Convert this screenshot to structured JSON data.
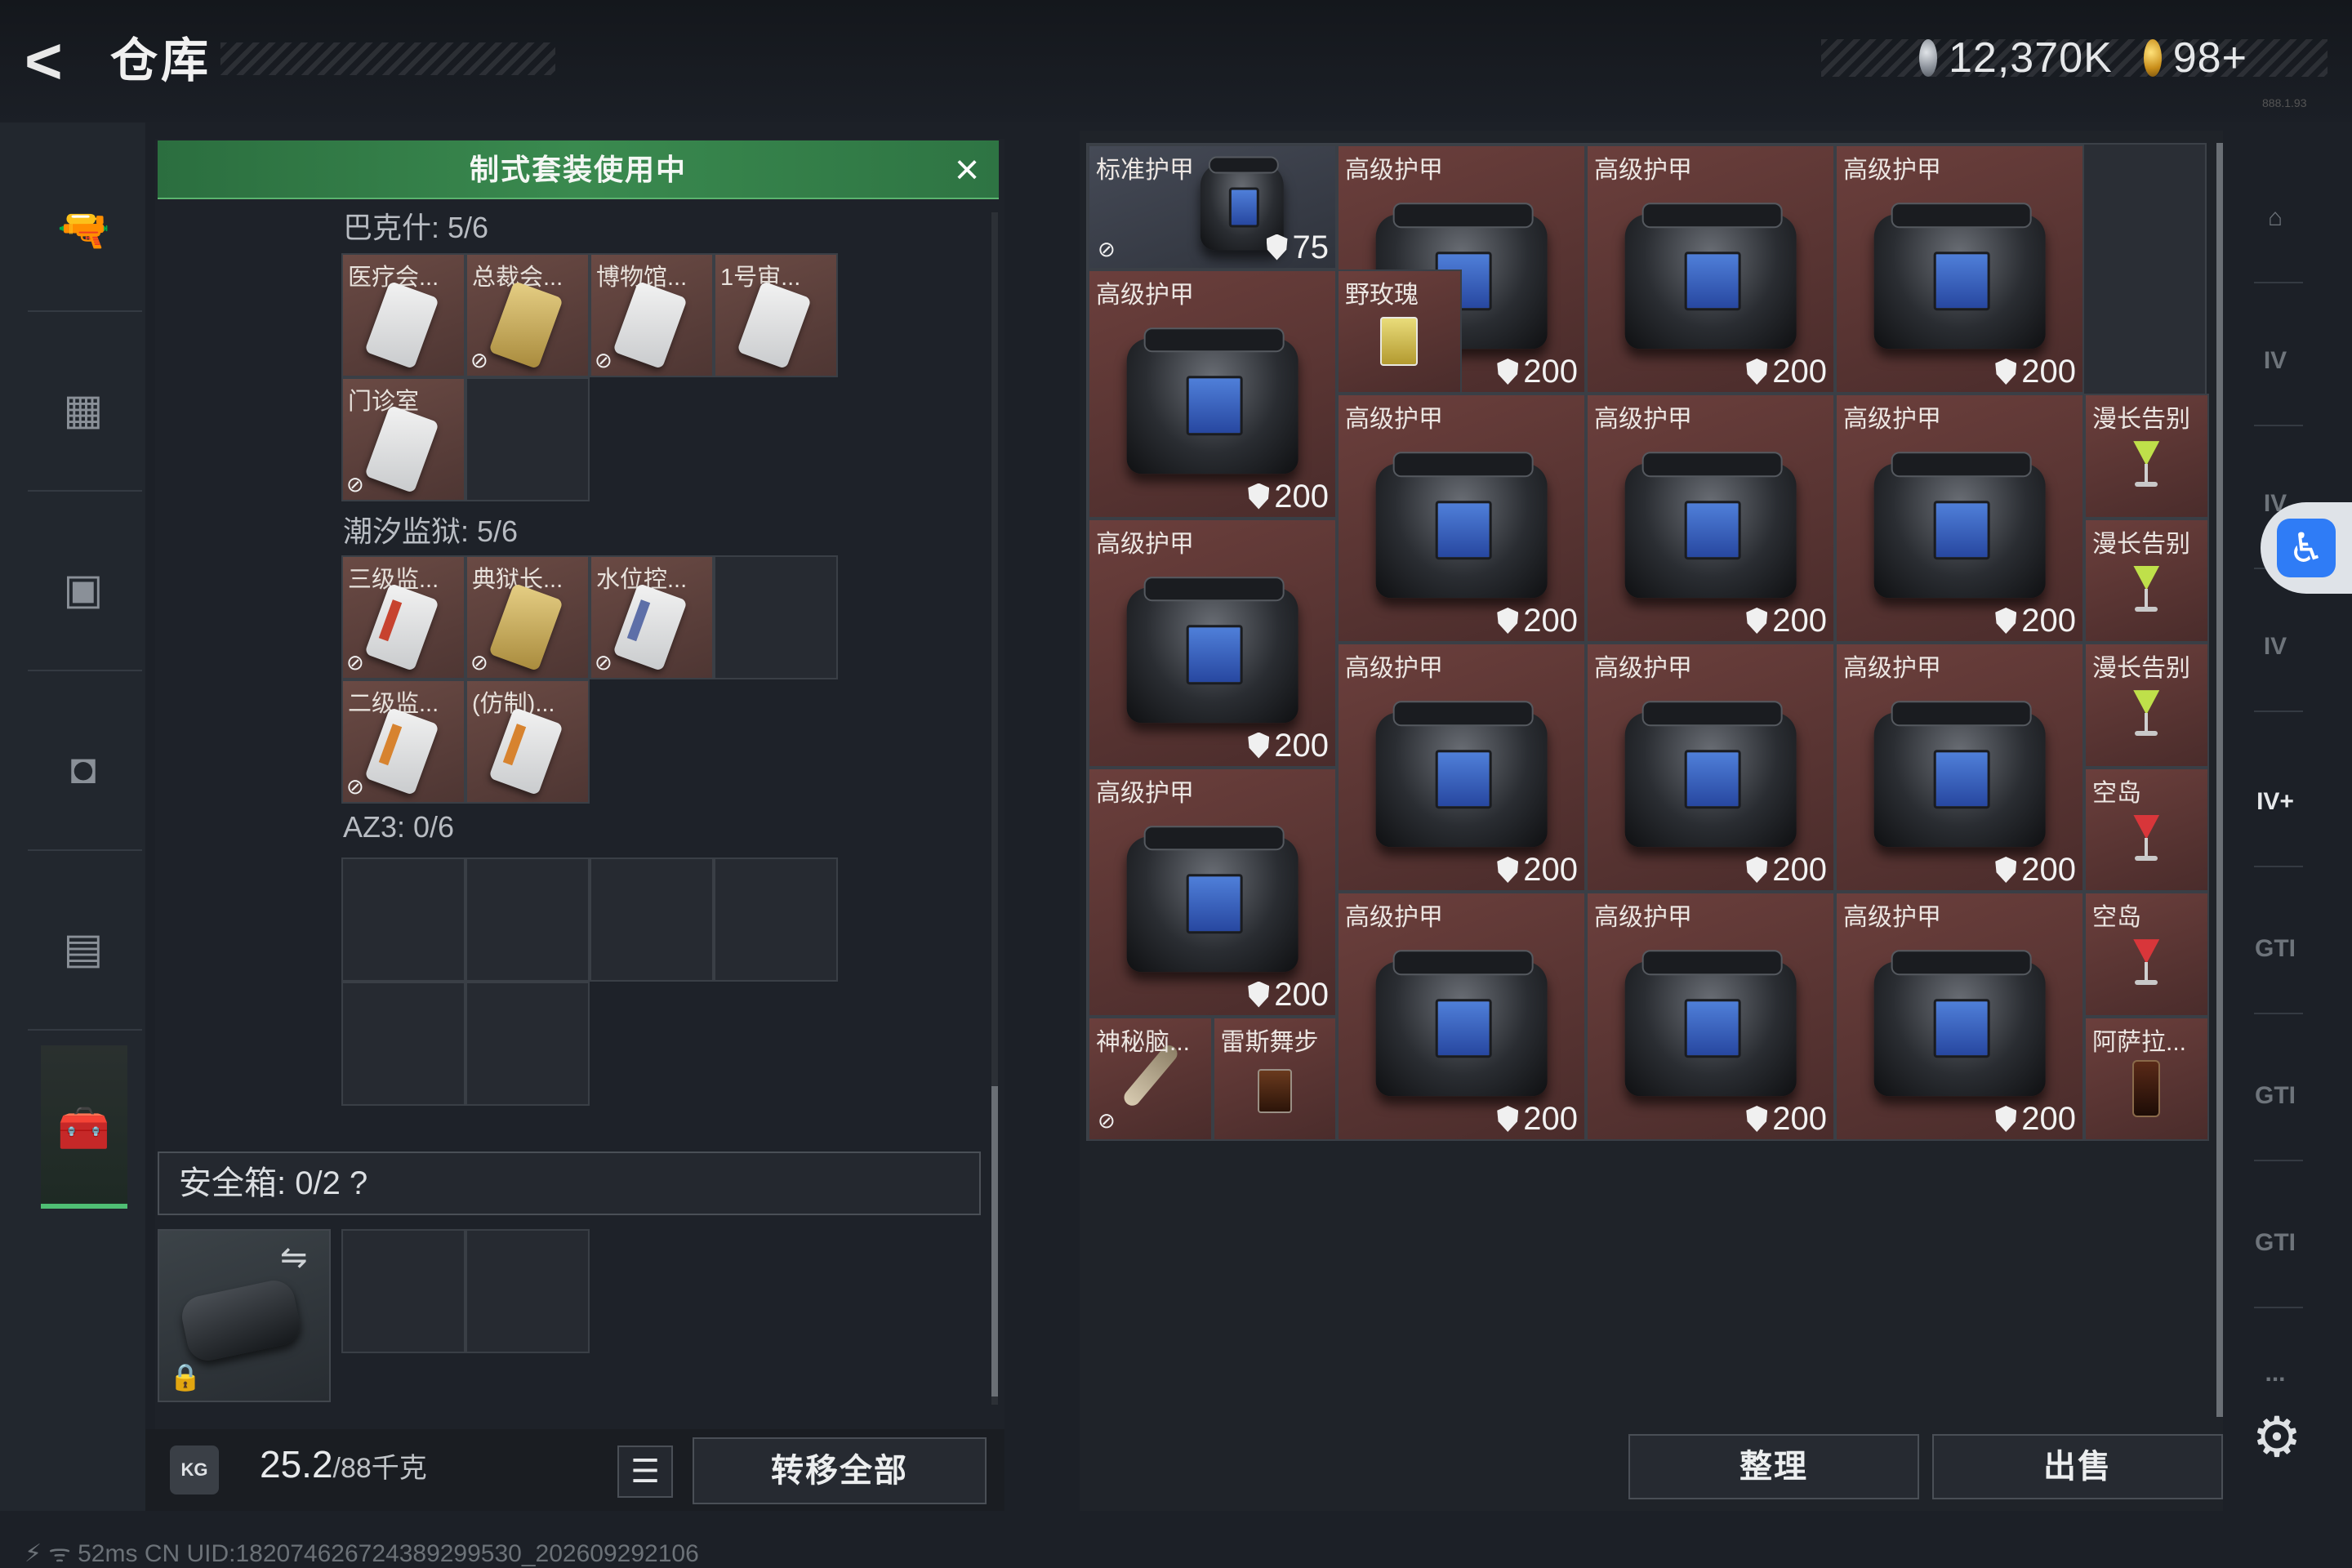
{
  "header": {
    "back_icon": "back-arrow-icon",
    "title": "仓库",
    "currency": [
      {
        "icon": "silver-coin-icon",
        "value": "12,370K"
      },
      {
        "icon": "gold-coin-icon",
        "value": "98+"
      }
    ]
  },
  "left_nav": {
    "items": [
      {
        "icon": "gun-icon",
        "glyph": "🔫"
      },
      {
        "icon": "vest-icon",
        "glyph": "▦"
      },
      {
        "icon": "chest-rig-icon",
        "glyph": "▣"
      },
      {
        "icon": "backpack-icon",
        "glyph": "◘"
      },
      {
        "icon": "container-icon",
        "glyph": "▤"
      },
      {
        "icon": "briefcase-icon",
        "glyph": "🧰",
        "active": true
      }
    ]
  },
  "kit": {
    "banner": "制式套装使用中",
    "close_icon": "close-icon",
    "sections": [
      {
        "title": "巴克什: 5/6",
        "slots": [
          {
            "label": "医疗会...",
            "card": "white",
            "bound": false
          },
          {
            "label": "总裁会...",
            "card": "gold",
            "bound": true
          },
          {
            "label": "博物馆...",
            "card": "white",
            "bound": true
          },
          {
            "label": "1号审...",
            "card": "white",
            "bound": false
          },
          {
            "label": "门诊室",
            "card": "white",
            "bound": true
          },
          {
            "label": "",
            "card": "",
            "bound": false
          }
        ]
      },
      {
        "title": "潮汐监狱: 5/6",
        "slots": [
          {
            "label": "三级监...",
            "card": "red",
            "bound": true
          },
          {
            "label": "典狱长...",
            "card": "gold",
            "bound": true
          },
          {
            "label": "水位控...",
            "card": "blue",
            "bound": true
          },
          {
            "label": "",
            "card": "",
            "bound": false
          },
          {
            "label": "二级监...",
            "card": "orange",
            "bound": true
          },
          {
            "label": "(仿制)...",
            "card": "orange",
            "bound": false
          }
        ]
      },
      {
        "title": "AZ3: 0/6",
        "slots": []
      }
    ]
  },
  "safe_box": {
    "label": "安全箱: 0/2 ?",
    "swap_icon": "swap-icon",
    "lock_icon": "lock-icon"
  },
  "weight": {
    "icon": "KG",
    "value": "25.2",
    "capacity": "/88千克"
  },
  "buttons": {
    "list_icon": "list-icon",
    "transfer_all": "转移全部",
    "sort": "整理",
    "sell": "出售"
  },
  "status_bar": "⚡ ᯤ 52ms   CN UID:182074626724389299530_202609292106",
  "tiny_corner": "888.1.93",
  "inventory": [
    {
      "label": "标准护甲",
      "type": "bag",
      "durability": "75",
      "style": "std",
      "bound": true
    },
    {
      "label": "高级护甲",
      "type": "bag",
      "durability": "200"
    },
    {
      "label": "高级护甲",
      "type": "bag",
      "durability": "200"
    },
    {
      "label": "高级护甲",
      "type": "bag",
      "durability": "200"
    },
    {
      "label": "高级护甲",
      "type": "bag",
      "durability": "200"
    },
    {
      "label": "野玫瑰",
      "type": "mug"
    },
    {
      "label": "高级护甲",
      "type": "bag",
      "durability": "200"
    },
    {
      "label": "高级护甲",
      "type": "bag",
      "durability": "200"
    },
    {
      "label": "高级护甲",
      "type": "bag",
      "durability": "200"
    },
    {
      "label": "漫长告别",
      "type": "cocktail-green"
    },
    {
      "label": "高级护甲",
      "type": "bag",
      "durability": "200"
    },
    {
      "label": "漫长告别",
      "type": "cocktail-green"
    },
    {
      "label": "高级护甲",
      "type": "bag",
      "durability": "200"
    },
    {
      "label": "高级护甲",
      "type": "bag",
      "durability": "200"
    },
    {
      "label": "高级护甲",
      "type": "bag",
      "durability": "200"
    },
    {
      "label": "漫长告别",
      "type": "cocktail-green"
    },
    {
      "label": "高级护甲",
      "type": "bag",
      "durability": "200"
    },
    {
      "label": "空岛",
      "type": "cocktail-red"
    },
    {
      "label": "高级护甲",
      "type": "bag",
      "durability": "200"
    },
    {
      "label": "高级护甲",
      "type": "bag",
      "durability": "200"
    },
    {
      "label": "高级护甲",
      "type": "bag",
      "durability": "200"
    },
    {
      "label": "空岛",
      "type": "cocktail-red"
    },
    {
      "label": "神秘脑...",
      "type": "wand",
      "bound": true
    },
    {
      "label": "雷斯舞步",
      "type": "tumbler"
    },
    {
      "label": "阿萨拉...",
      "type": "bottle"
    }
  ],
  "right_nav": [
    {
      "icon": "storage-tab-icon",
      "text": "⌂"
    },
    {
      "icon": "tab-iv-1-icon",
      "text": "IV"
    },
    {
      "icon": "tab-iv-2-icon",
      "text": "IV"
    },
    {
      "icon": "tab-iv-3-icon",
      "text": "IV"
    },
    {
      "icon": "tab-add-icon",
      "text": "IV+"
    },
    {
      "icon": "tab-gti-1-icon",
      "text": "GTI"
    },
    {
      "icon": "tab-gti-2-icon",
      "text": "GTI"
    },
    {
      "icon": "tab-gti-3-icon",
      "text": "GTI"
    },
    {
      "icon": "more-icon",
      "text": "..."
    }
  ],
  "accessibility_icon": "accessibility-icon",
  "settings_icon": "gear-icon"
}
